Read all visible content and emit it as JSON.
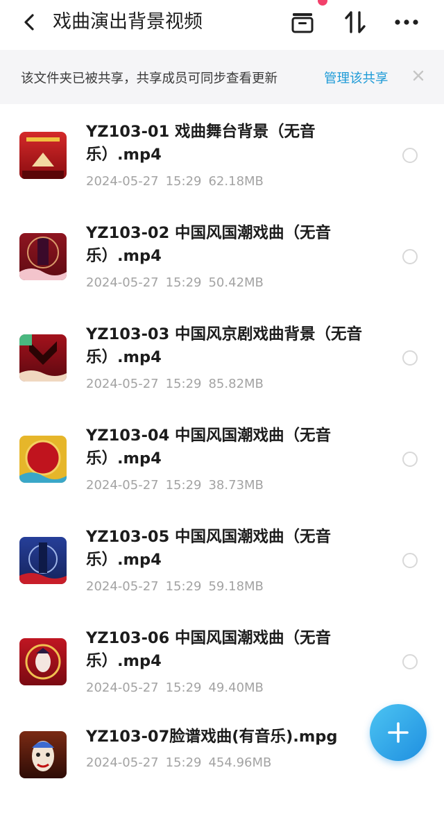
{
  "header": {
    "title": "戏曲演出背景视频",
    "icons": [
      "back-arrow-icon",
      "upload-tray-icon",
      "sort-icon",
      "more-icon"
    ]
  },
  "banner": {
    "text": "该文件夹已被共享，共享成员可同步查看更新",
    "link": "管理该共享",
    "close": "×"
  },
  "files": [
    {
      "name": "YZ103-01 戏曲舞台背景（无音乐）.mp4",
      "date": "2024-05-27",
      "time": "15:29",
      "size": "62.18MB",
      "thumb_color": "#b81f1f"
    },
    {
      "name": "YZ103-02 中国风国潮戏曲（无音乐）.mp4",
      "date": "2024-05-27",
      "time": "15:29",
      "size": "50.42MB",
      "thumb_color": "#7a0f18"
    },
    {
      "name": "YZ103-03 中国风京剧戏曲背景（无音乐）.mp4",
      "date": "2024-05-27",
      "time": "15:29",
      "size": "85.82MB",
      "thumb_color": "#8a0d14"
    },
    {
      "name": "YZ103-04 中国风国潮戏曲（无音乐）.mp4",
      "date": "2024-05-27",
      "time": "15:29",
      "size": "38.73MB",
      "thumb_color": "#b3121c"
    },
    {
      "name": "YZ103-05 中国风国潮戏曲（无音乐）.mp4",
      "date": "2024-05-27",
      "time": "15:29",
      "size": "59.18MB",
      "thumb_color": "#1f3a8a"
    },
    {
      "name": "YZ103-06 中国风国潮戏曲（无音乐）.mp4",
      "date": "2024-05-27",
      "time": "15:29",
      "size": "49.40MB",
      "thumb_color": "#a0101a"
    },
    {
      "name": "YZ103-07脸谱戏曲(有音乐).mpg",
      "date": "2024-05-27",
      "time": "15:29",
      "size": "454.96MB",
      "thumb_color": "#5a1a10"
    }
  ],
  "fab": {
    "label": "+"
  }
}
